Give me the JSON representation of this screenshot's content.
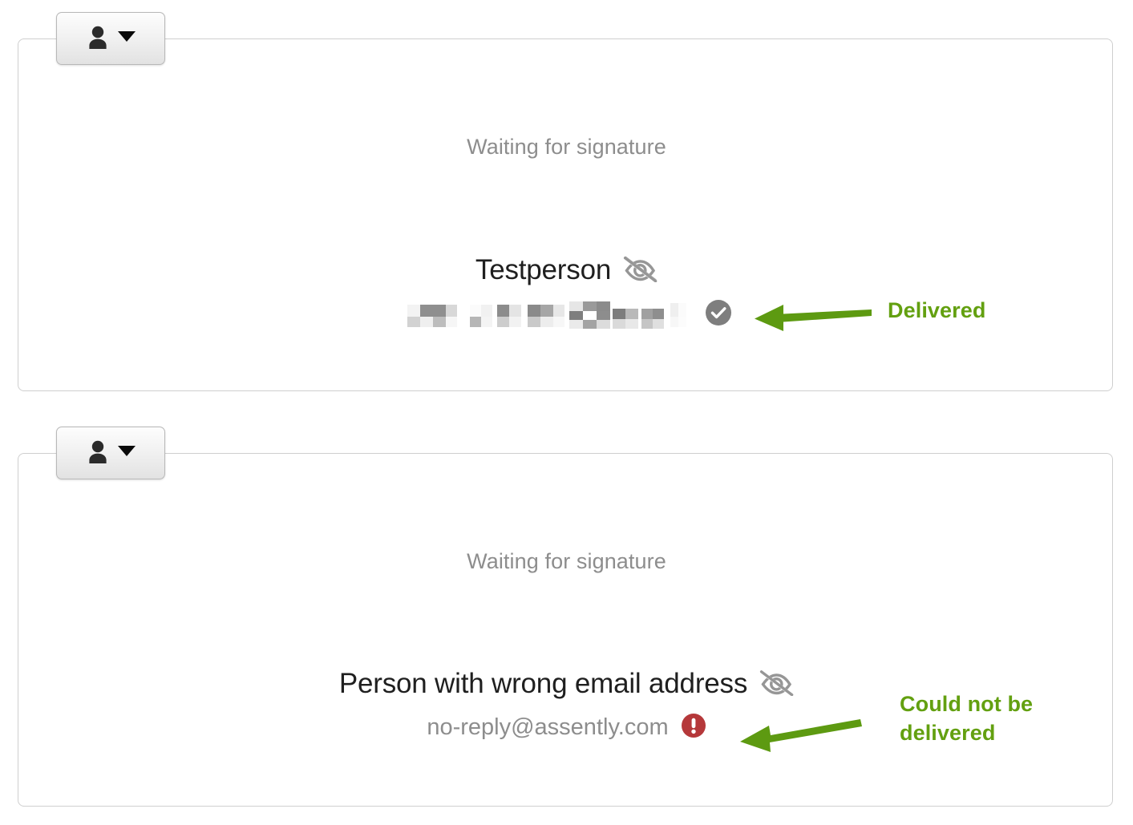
{
  "theme": {
    "card_border": "#cfcfcf",
    "muted_text": "#8d8d8d",
    "name_text": "#1f1f1f",
    "annotation_green": "#63a010",
    "arrow_green": "#5d9a11",
    "delivered_icon_gray": "#7e7e7e",
    "error_icon_red": "#b5383a",
    "eye_icon_gray": "#969696"
  },
  "cards": [
    {
      "person_menu": {
        "person_icon": "person-icon",
        "caret_icon": "chevron-down-icon",
        "aria_label": "Recipient options"
      },
      "status_label": "Waiting for signature",
      "recipient_name": "Testperson",
      "visibility_icon": "eye-off-icon",
      "email": "",
      "email_redacted": true,
      "delivery_icon": "check-circle-icon",
      "delivery_state": "delivered"
    },
    {
      "person_menu": {
        "person_icon": "person-icon",
        "caret_icon": "chevron-down-icon",
        "aria_label": "Recipient options"
      },
      "status_label": "Waiting for signature",
      "recipient_name": "Person with wrong email address",
      "visibility_icon": "eye-off-icon",
      "email": "no-reply@assently.com",
      "email_redacted": false,
      "delivery_icon": "error-circle-icon",
      "delivery_state": "failed"
    }
  ],
  "annotations": [
    {
      "label": "Delivered",
      "arrow_icon": "left-arrow-icon",
      "points_to": "delivery-status-icon-card-1"
    },
    {
      "label": "Could not be\ndelivered",
      "arrow_icon": "left-arrow-icon",
      "points_to": "delivery-status-icon-card-2"
    }
  ]
}
